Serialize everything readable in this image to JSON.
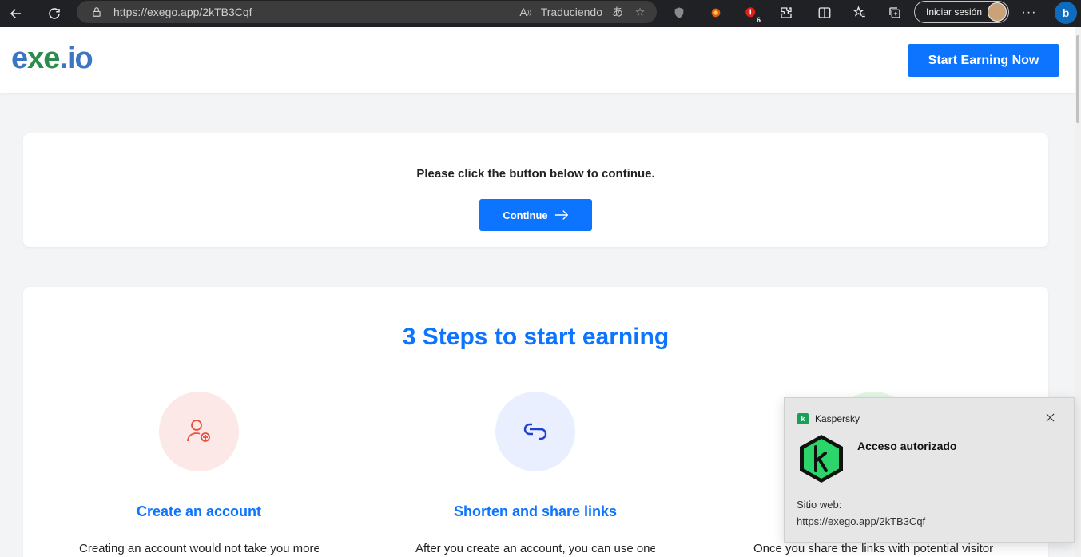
{
  "browser": {
    "url": "https://exego.app/2kTB3Cqf",
    "translate_status": "Traduciendo",
    "signin_label": "Iniciar sesión",
    "ext_badge": "6"
  },
  "header": {
    "logo_left": "e",
    "logo_x": "xe",
    "logo_right": ".io",
    "start_button": "Start Earning Now"
  },
  "continue_card": {
    "message": "Please click the button below to continue.",
    "button": "Continue"
  },
  "steps_card": {
    "heading": "3 Steps to start earning",
    "steps": [
      {
        "title": "Create an account",
        "desc": "Creating an account would not take you more than",
        "circle_color": "#fde8e8",
        "icon_color": "#ef4d3c"
      },
      {
        "title": "Shorten and share links",
        "desc": "After you create an account, you can use one of",
        "circle_color": "#e9efff",
        "icon_color": "#1e3fd4"
      },
      {
        "title": "",
        "desc": "Once you share the links with potential visitors",
        "circle_color": "#e4f7e8",
        "icon_color": "#2c9c4d"
      }
    ]
  },
  "toast": {
    "brand": "Kaspersky",
    "title": "Acceso autorizado",
    "site_label": "Sitio web:",
    "site_url": "https://exego.app/2kTB3Cqf"
  }
}
